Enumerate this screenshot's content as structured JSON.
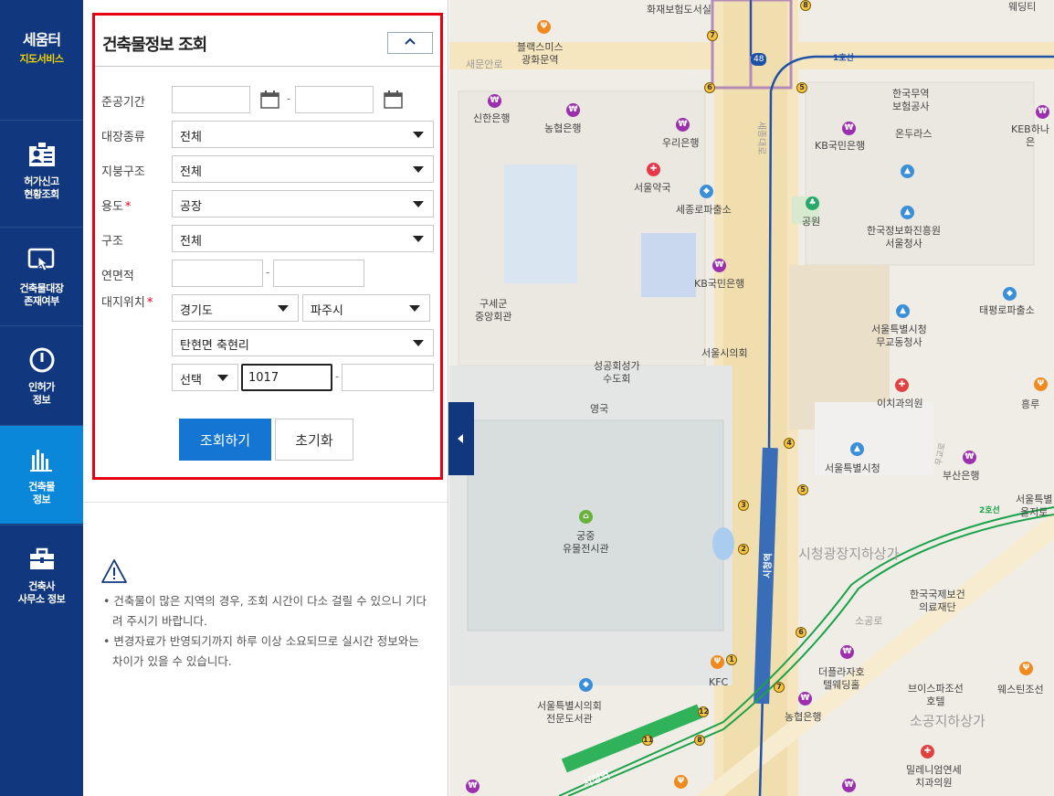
{
  "brand": {
    "title": "세움터",
    "subtitle": "지도서비스"
  },
  "nav": [
    {
      "label": "허가신고\n현황조회",
      "icon": "id-card-icon",
      "active": false
    },
    {
      "label": "건축물대장\n존재여부",
      "icon": "touch-screen-icon",
      "active": false
    },
    {
      "label": "인허가\n정보",
      "icon": "clock-icon",
      "active": false
    },
    {
      "label": "건축물\n정보",
      "icon": "bar-chart-icon",
      "active": true
    },
    {
      "label": "건축사\n사무소 정보",
      "icon": "briefcase-icon",
      "active": false
    }
  ],
  "panel": {
    "title": "건축물정보 조회",
    "fields": {
      "completion_period": {
        "label": "준공기간",
        "from": "",
        "to": ""
      },
      "ledger_type": {
        "label": "대장종류",
        "value": "전체"
      },
      "roof_structure": {
        "label": "지붕구조",
        "value": "전체"
      },
      "usage": {
        "label": "용도",
        "value": "공장",
        "required": "*"
      },
      "structure": {
        "label": "구조",
        "value": "전체"
      },
      "floor_area": {
        "label": "연면적",
        "from": "",
        "to": ""
      },
      "site_location": {
        "label": "대지위치",
        "required": "*",
        "province": "경기도",
        "city": "파주시",
        "town": "탄현면 축현리",
        "lot_type": "선택",
        "main_no": "1017",
        "sub_no": ""
      }
    },
    "dash": "-",
    "search_label": "조회하기",
    "reset_label": "초기화",
    "notices": [
      "• 건축물이 많은 지역의 경우, 조회 시간이 다소 걸릴 수 있으니 기다려 주시기 바랍니다.",
      "• 변경자료가 반영되기까지 하루 이상 소요되므로 실시간 정보와는 차이가 있을 수 있습니다."
    ]
  },
  "map": {
    "labels": [
      "화재보험도서실",
      "웨딩티",
      "블랙스미스\n광화문역",
      "새문안로",
      "신한은행",
      "농협은행",
      "우리은행",
      "한국무역\n보험공사",
      "KB국민은행",
      "온두라스",
      "KEB하나은",
      "서울약국",
      "세종로파출소",
      "공원",
      "한국정보화진흥원\n서울청사",
      "KB국민은행",
      "구세군\n중앙회관",
      "서울시의회",
      "태평로파출소",
      "서울특별시청\n무교동청사",
      "성공회성가\n수도회",
      "영국",
      "이치과의원",
      "흥루",
      "서울특별시청",
      "부산은행",
      "서울특별\n을지로",
      "궁중\n유물전시관",
      "시청광장지하상가",
      "한국국제보건\n의료재단",
      "소공로",
      "KFC",
      "더플라자호\n텔웨딩홀",
      "브이스파조선\n호텔",
      "웨스틴조선",
      "서울특별시의회\n전문도서관",
      "농협은행",
      "소공지하상가",
      "밀레니엄연세\n치과의원",
      "시청역",
      "1호선",
      "2호선",
      "48",
      "시청역",
      "세종대로",
      "무교로"
    ]
  }
}
